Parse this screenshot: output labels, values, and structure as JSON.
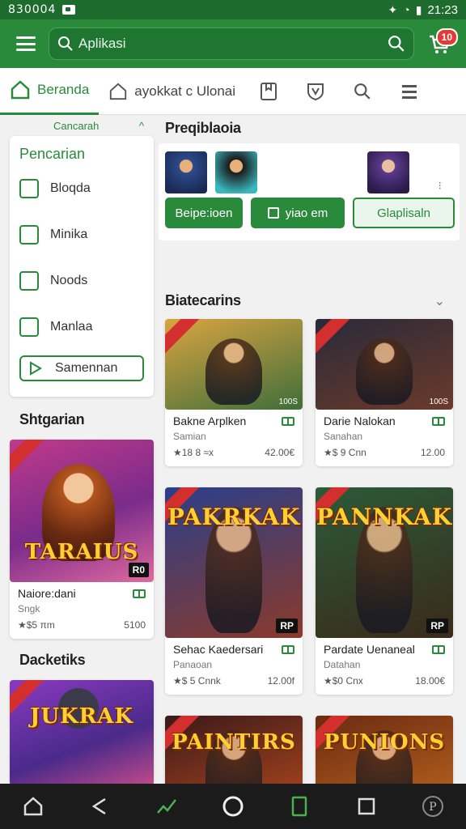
{
  "status": {
    "time": "830004",
    "clock": "21:23"
  },
  "header": {
    "search_placeholder": "Aplikasi",
    "cart_count": "10"
  },
  "nav": {
    "tabs": [
      {
        "label": "Beranda"
      },
      {
        "label": "ayokkat c Ulonai"
      }
    ]
  },
  "sidebar": {
    "cancel_label": "Cancarah",
    "filter_title": "Pencarian",
    "filters": [
      {
        "label": "Bloqda"
      },
      {
        "label": "Minika"
      },
      {
        "label": "Noods"
      },
      {
        "label": "Manlaa"
      }
    ],
    "filter_button": "Samennan",
    "section_title": "Shtgarian",
    "card": {
      "art_title": "TARAIUS",
      "tag": "R0",
      "name": "Naiore:dani",
      "sub": "Sngk",
      "rating": "★$5 πm",
      "price": "5100"
    },
    "section2_title": "Dacketiks",
    "card2": {
      "art_title": "JUKRAK"
    }
  },
  "main": {
    "promo_title": "Preqiblaoia",
    "promo_buttons": [
      {
        "label": "Beipe:ioen"
      },
      {
        "label": "yiao em"
      },
      {
        "label": "Glaplisaln"
      }
    ],
    "section_title": "Biatecarins",
    "cards": [
      {
        "art_title": "",
        "tag": "",
        "corner": "100S",
        "name": "Bakne Arplken",
        "sub": "Samian",
        "rating": "★18 8 ≈x",
        "price": "42.00€",
        "palette": [
          "#d9a441",
          "#3f6e3a"
        ]
      },
      {
        "art_title": "",
        "tag": "",
        "corner": "100S",
        "name": "Darie Nalokan",
        "sub": "Sanahan",
        "rating": "★$ 9 Cnn",
        "price": "12.00",
        "palette": [
          "#2a2a3a",
          "#6b3a2a"
        ]
      },
      {
        "art_title": "PAKRKAK",
        "tag": "RP",
        "corner": "",
        "name": "Sehac Kaedersari",
        "sub": "Panaoan",
        "rating": "★$ 5 Cnnk",
        "price": "12.00f",
        "palette": [
          "#2b3f8a",
          "#8a3a2b"
        ]
      },
      {
        "art_title": "PANNKAK",
        "tag": "RP",
        "corner": "",
        "name": "Pardate Uenaneal",
        "sub": "Datahan",
        "rating": "★$0 Cnx",
        "price": "18.00€",
        "palette": [
          "#2b5a3a",
          "#3a2a1a"
        ]
      },
      {
        "art_title": "PAINTIRS",
        "tag": "",
        "corner": "",
        "name": "",
        "sub": "",
        "rating": "",
        "price": "",
        "palette": [
          "#3a1a1a",
          "#b94a1e"
        ]
      },
      {
        "art_title": "PUNIONS",
        "tag": "",
        "corner": "",
        "name": "",
        "sub": "",
        "rating": "",
        "price": "",
        "palette": [
          "#6b2a12",
          "#c0681e"
        ]
      }
    ]
  },
  "colors": {
    "brand": "#2a8a3b",
    "brand_dark": "#1d6b2d",
    "badge": "#e53935"
  }
}
